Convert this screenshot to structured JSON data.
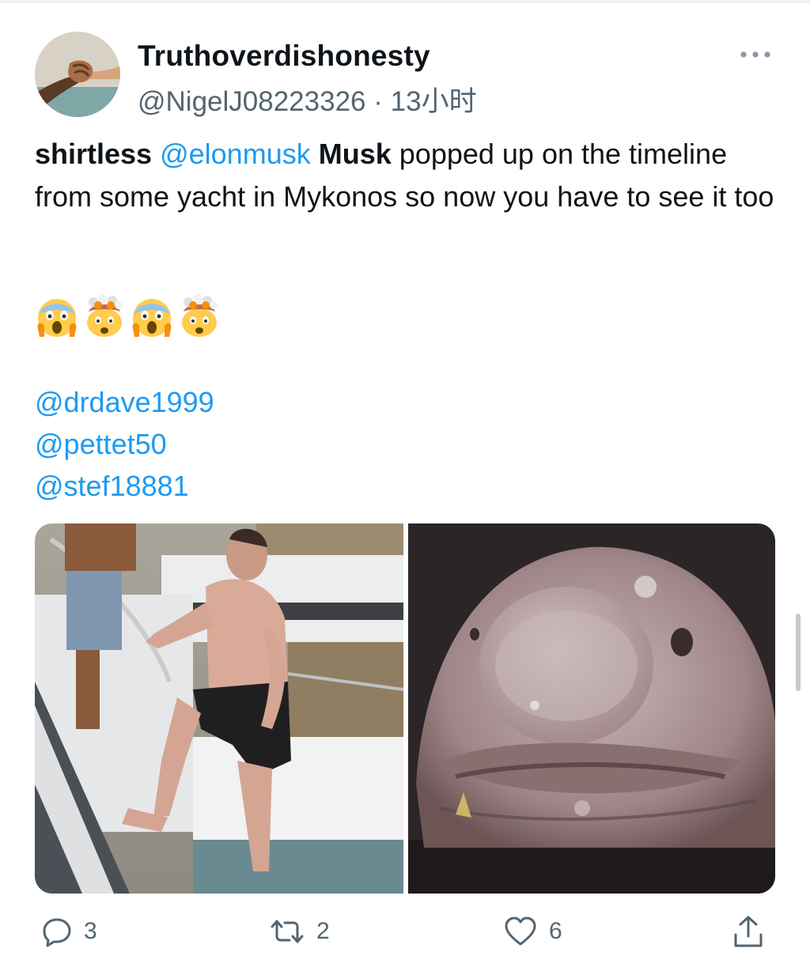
{
  "tweet": {
    "display_name": "Truthoverdishonesty",
    "handle": "@NigelJ08223326",
    "separator": "·",
    "time": "13小时",
    "text": {
      "word1": "shirtless",
      "mention1": "@elonmusk",
      "word2": "Musk",
      "rest": "popped up on the timeline from some yacht in Mykonos so now you have to see it too"
    },
    "emojis": [
      "screaming-face-emoji",
      "exploding-head-emoji",
      "screaming-face-emoji",
      "exploding-head-emoji"
    ],
    "mentions": [
      "@drdave1999",
      "@pettet50",
      "@stef18881"
    ],
    "media": [
      {
        "name": "photo-man-on-yacht"
      },
      {
        "name": "photo-blobfish"
      }
    ],
    "actions": {
      "reply_count": "3",
      "retweet_count": "2",
      "like_count": "6"
    }
  },
  "colors": {
    "link": "#1d9bf0",
    "text": "#0f1419",
    "secondary": "#536471"
  }
}
